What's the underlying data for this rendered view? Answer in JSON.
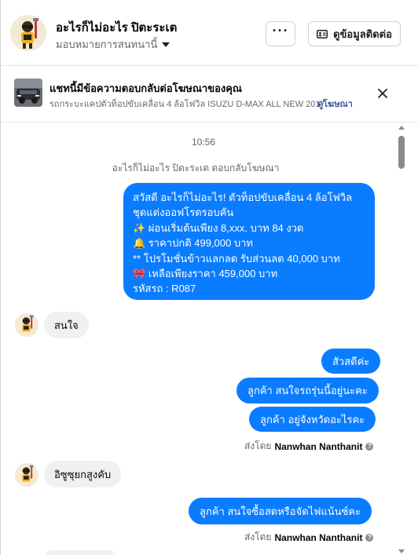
{
  "header": {
    "name": "อะไรก็ไม่อะไร ปิตะระเต",
    "subtitle": "มอบหมายการสนทนานี้",
    "more_label": "···",
    "contact_label": "ดูข้อมูลติดต่อ"
  },
  "ad": {
    "title": "แชทนี้มีข้อความตอบกลับต่อโฆษณาของคุณ",
    "description": "รถกระบะแคปตัวท็อปขับเคลื่อน 4 ล้อโฟวิล ISUZU D-MAX ALL NEW 2017...",
    "link_label": "ดูโฆษณา"
  },
  "chat": {
    "timestamp": "10:56",
    "system_note": "อะไรก็ไม่อะไร ปิตะระเต ตอบกลับโฆษณา",
    "ad_message_lines": [
      "สวัสดี อะไรก็ไม่อะไร! ตัวท็อปขับเคลื่อน 4 ล้อโฟวิล",
      "ชุดแต่งออฟโรดรอบคัน",
      "✨  ผ่อนเริ่มต้นเพียง 8,xxx. บาท 84 งวด",
      "🔔 ราคาปกติ 499,000 บาท",
      "** โปรโมชั่นข้าวแลกลด รับส่วนลด 40,000 บาท",
      "🎀  เหลือเพียงราคา 459,000 บาท",
      " รหัสรถ : R087"
    ],
    "in_1": "สนใจ",
    "out_1": "สัวสดีค่ะ",
    "out_2": "ลูกค้า สนใจรถรุ่นนี้อยู่นะคะ",
    "out_3": "ลูกค้า อยู่จังหวัดอะไรคะ",
    "sent_by_prefix": "ส่งโดย",
    "sent_by_name": "Nanwhan Nanthanit",
    "in_2": "อิซูซุยกสูงคับ",
    "out_4": "ลูกค้า สนใจซื้อสดหรือจัดไฟแน้นซ์คะ"
  },
  "colors": {
    "bubble_out": "#0a7cff",
    "bubble_in": "#f0f0f0",
    "link": "#385898"
  }
}
